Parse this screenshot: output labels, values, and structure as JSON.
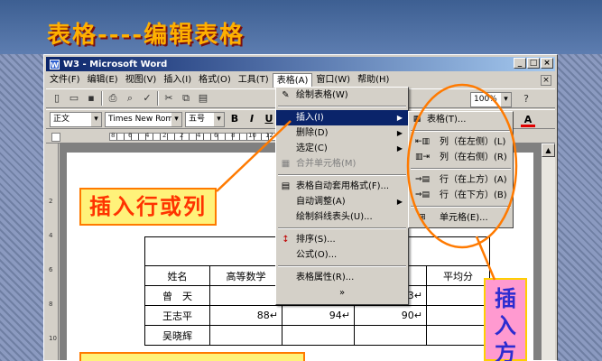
{
  "slide": {
    "title": "表格----编辑表格"
  },
  "window": {
    "title": "W3 - Microsoft Word",
    "min": "_",
    "max": "□",
    "close": "×"
  },
  "menubar": {
    "items": [
      "文件(F)",
      "编辑(E)",
      "视图(V)",
      "插入(I)",
      "格式(O)",
      "工具(T)",
      "表格(A)",
      "窗口(W)",
      "帮助(H)"
    ],
    "close": "×"
  },
  "toolbar": {
    "zoom": "100%",
    "help": "?"
  },
  "format_bar": {
    "style": "正文",
    "font": "Times New Roman",
    "size": "五号",
    "bold": "B",
    "italic": "I",
    "underline": "U",
    "font_color": "A"
  },
  "ruler": {
    "numbers": [
      "8",
      "6",
      "4",
      "2",
      "2",
      "4",
      "6",
      "8",
      "10",
      "12",
      "14",
      "16",
      "18",
      "20",
      "22",
      "24",
      "26",
      "28",
      "30",
      "32",
      "34",
      "38"
    ]
  },
  "vruler": {
    "numbers": [
      "2",
      "4",
      "6",
      "8",
      "10",
      "12"
    ]
  },
  "table_menu": {
    "items": [
      {
        "label": "绘制表格(W)",
        "icon": "pencil-icon",
        "state": "normal"
      },
      {
        "label": "插入(I)",
        "icon": "",
        "state": "selected",
        "submenu": true
      },
      {
        "label": "删除(D)",
        "icon": "",
        "state": "normal",
        "submenu": true
      },
      {
        "label": "选定(C)",
        "icon": "",
        "state": "normal",
        "submenu": true
      },
      {
        "label": "合并单元格(M)",
        "icon": "merge-cells-icon",
        "state": "disabled"
      },
      {
        "label": "表格自动套用格式(F)...",
        "icon": "autoformat-icon",
        "state": "normal"
      },
      {
        "label": "自动调整(A)",
        "icon": "",
        "state": "normal",
        "submenu": true
      },
      {
        "label": "绘制斜线表头(U)...",
        "icon": "",
        "state": "normal"
      },
      {
        "label": "排序(S)...",
        "icon": "sort-icon",
        "state": "normal"
      },
      {
        "label": "公式(O)...",
        "icon": "",
        "state": "normal"
      },
      {
        "label": "表格属性(R)...",
        "icon": "",
        "state": "normal"
      },
      {
        "label": "»",
        "icon": "",
        "state": "more"
      }
    ]
  },
  "insert_submenu": {
    "items": [
      {
        "label": "表格(T)...",
        "icon": "table-icon"
      },
      {
        "label": "列（在左侧）(L)",
        "icon": "column-left-icon"
      },
      {
        "label": "列（在右侧）(R)",
        "icon": "column-right-icon"
      },
      {
        "label": "行（在上方）(A)",
        "icon": "row-above-icon"
      },
      {
        "label": "行（在下方）(B)",
        "icon": "row-below-icon"
      },
      {
        "label": "单元格(E)...",
        "icon": "cell-icon"
      }
    ]
  },
  "doc_table": {
    "headers": [
      "姓名",
      "高等数学",
      "",
      "基础",
      "平均分"
    ],
    "rows": [
      [
        "曾　天",
        "",
        "",
        "93",
        ""
      ],
      [
        "王志平",
        "88",
        "94",
        "90",
        ""
      ],
      [
        "吴晓辉",
        "",
        "",
        "",
        ""
      ],
      [
        "",
        "",
        "",
        "",
        ""
      ]
    ],
    "row_marks": {
      "row1_col2": "",
      "row2_col2": "88↵",
      "row2_col3": "94↵",
      "row2_col4": "90↵",
      "row1_col4": "93↵"
    }
  },
  "callouts": {
    "left": "插入行或列",
    "right": "插入方",
    "bottom": ""
  },
  "colors": {
    "title": "#ffb000",
    "callout_border": "#ff7a00",
    "arrow": "#ff7a00"
  }
}
